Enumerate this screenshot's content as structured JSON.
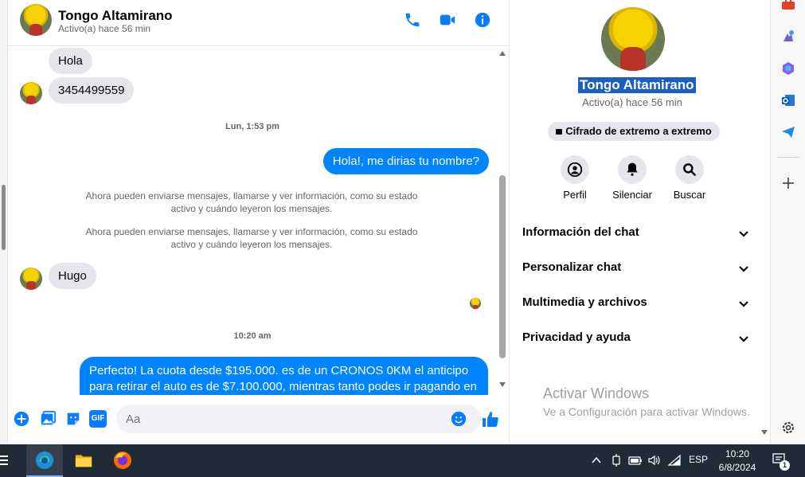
{
  "chat": {
    "contact_name": "Tongo Altamirano",
    "contact_status": "Activo(a) hace 56 min",
    "messages": {
      "m1": "Hola",
      "m2": "3454499559",
      "sep1": "Lun, 1:53 pm",
      "m3": "Hola!, me dirias tu nombre?",
      "sys1_l1": "Ahora pueden enviarse mensajes, llamarse y ver información, como su estado",
      "sys1_l2": "activo y cuándo leyeron los mensajes.",
      "sys2_l1": "Ahora pueden enviarse mensajes, llamarse y ver información, como su estado",
      "sys2_l2": "activo y cuándo leyeron los mensajes.",
      "m4": "Hugo",
      "sep2": "10:20 am",
      "m5_l1": "Perfecto! La cuota desde $195.000. es de un CRONOS 0KM el anticipo",
      "m5_l2": "para retirar el auto es de $7.100.000, mientras tanto podes ir pagando en"
    },
    "composer": {
      "placeholder": "Aa",
      "gif_label": "GIF"
    }
  },
  "info_panel": {
    "name": "Tongo Altamirano",
    "status": "Activo(a) hace 56 min",
    "encryption": "Cifrado de extremo a extremo",
    "actions": {
      "profile": "Perfil",
      "mute": "Silenciar",
      "search": "Buscar"
    },
    "sections": {
      "chat_info": "Información del chat",
      "customize": "Personalizar chat",
      "media": "Multimedia y archivos",
      "privacy": "Privacidad y ayuda"
    },
    "watermark_title": "Activar Windows",
    "watermark_sub": "Ve a Configuración para activar Windows."
  },
  "taskbar": {
    "language": "ESP",
    "time": "10:20",
    "date": "6/8/2024",
    "notification_count": "1"
  },
  "colors": {
    "messenger_blue": "#0084ff",
    "icon_blue": "#0a7cff",
    "incoming_bubble": "#e4e6eb",
    "taskbar": "#1f2b36"
  }
}
